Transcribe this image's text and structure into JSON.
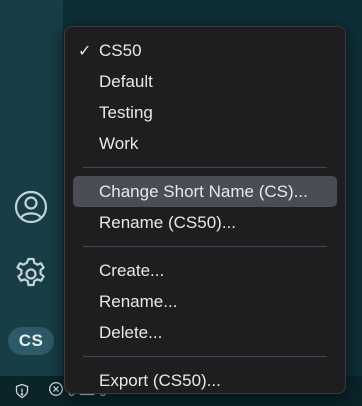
{
  "activity_bar": {
    "account_icon": "account-icon",
    "manage_icon": "gear-icon",
    "profile_badge": "CS"
  },
  "status_bar": {
    "shield_icon": "shield-icon",
    "errors_icon": "error-icon",
    "errors_count": "0",
    "warnings_icon": "warning-icon",
    "warnings_count": "0"
  },
  "menu": {
    "profiles": [
      {
        "label": "CS50",
        "checked": true
      },
      {
        "label": "Default",
        "checked": false
      },
      {
        "label": "Testing",
        "checked": false
      },
      {
        "label": "Work",
        "checked": false
      }
    ],
    "current_profile_actions": [
      {
        "label": "Change Short Name (CS)...",
        "highlighted": true
      },
      {
        "label": "Rename (CS50)...",
        "highlighted": false
      }
    ],
    "profile_actions": [
      {
        "label": "Create..."
      },
      {
        "label": "Rename..."
      },
      {
        "label": "Delete..."
      }
    ],
    "export": {
      "label": "Export (CS50)..."
    },
    "check_glyph": "✓"
  },
  "colors": {
    "activity_bar": "#173d45",
    "menu_background": "#1e1e20",
    "menu_highlight": "#4a4d53",
    "badge": "#2c5b67"
  }
}
